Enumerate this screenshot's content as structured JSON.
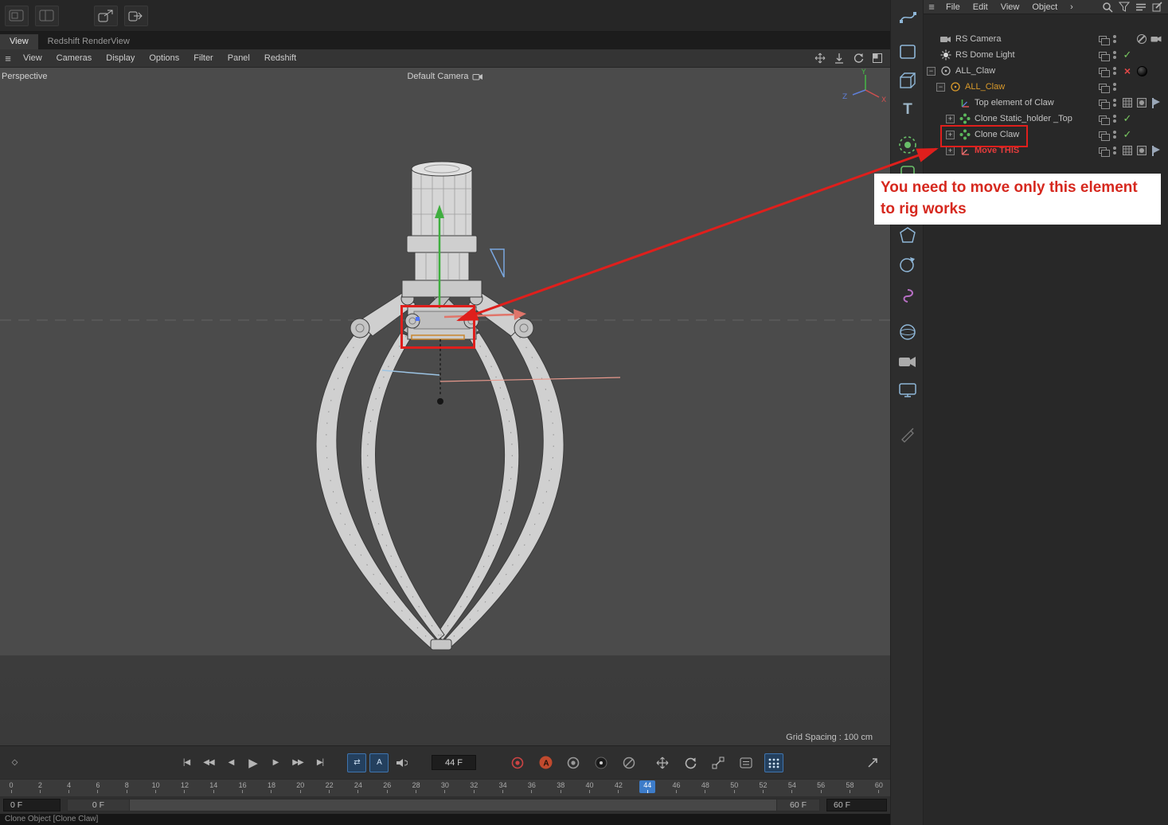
{
  "colors": {
    "accent_blue": "#3d7cc9",
    "annotation_red": "#df1f1c",
    "selected_orange": "#d99a2b",
    "check_green": "#79c961",
    "cross_red": "#e24848"
  },
  "top_tabs": {
    "view": "View",
    "redshift": "Redshift RenderView"
  },
  "viewport_menu": {
    "items": [
      "View",
      "Cameras",
      "Display",
      "Options",
      "Filter",
      "Panel",
      "Redshift"
    ]
  },
  "viewport": {
    "view_label": "Perspective",
    "camera_label": "Default Camera",
    "grid_spacing": "Grid Spacing : 100 cm",
    "axis": {
      "x": "X",
      "y": "Y",
      "z": "Z"
    }
  },
  "object_manager": {
    "menu_items": [
      "File",
      "Edit",
      "View",
      "Object"
    ],
    "rows": [
      {
        "label": "RS Camera",
        "status": ""
      },
      {
        "label": "RS Dome Light",
        "status": "check"
      },
      {
        "label": "ALL_Claw",
        "status": "cross"
      },
      {
        "label": "ALL_Claw",
        "status": "selected"
      },
      {
        "label": "Top element of Claw",
        "status": ""
      },
      {
        "label": "Clone Static_holder _Top",
        "status": "check"
      },
      {
        "label": "Clone Claw",
        "status": "check"
      },
      {
        "label": "Move THIS",
        "status": "highlighted-red"
      }
    ]
  },
  "annotation": {
    "line1": "You need to move only this element",
    "line2": "to rig works"
  },
  "timeline": {
    "frame_field": "44 F",
    "current_frame": 44,
    "ticks": [
      0,
      2,
      4,
      6,
      8,
      10,
      12,
      14,
      16,
      18,
      20,
      22,
      24,
      26,
      28,
      30,
      32,
      34,
      36,
      38,
      40,
      42,
      44,
      46,
      48,
      50,
      52,
      54,
      56,
      58,
      60
    ],
    "range_start_field": "0 F",
    "range_start_handle": "0 F",
    "range_end_handle": "60 F",
    "range_end_field": "60 F"
  },
  "status_bar": {
    "text": "Clone Object [Clone Claw]"
  },
  "icons": {
    "hamburger": "≡",
    "menu_overflow": "›",
    "keyframe_diamond": "◇",
    "go_start": "|◀",
    "prev_key": "◀◀",
    "prev_frame": "◀",
    "play": "▶",
    "next_frame": "▶",
    "next_key": "▶▶",
    "go_end": "▶|",
    "loop": "⇄",
    "autokey_letter": "A",
    "check": "✓",
    "cross": "×",
    "expand_minus": "−",
    "expand_plus": "+",
    "text_tool": "T"
  }
}
